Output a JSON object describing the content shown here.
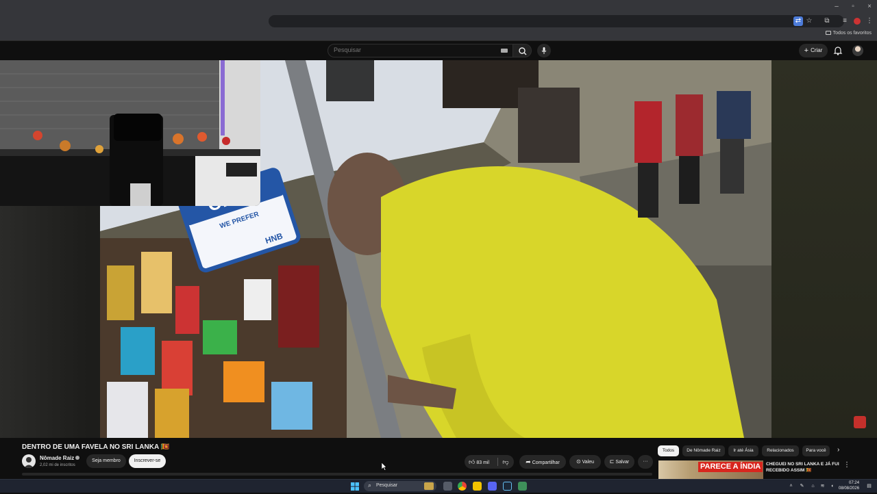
{
  "browser": {
    "bookmarks_all": "Todos os favoritos"
  },
  "youtube": {
    "search_placeholder": "Pesquisar",
    "create_label": "Criar"
  },
  "video": {
    "title": "DENTRO DE UMA FAVELA NO SRI LANKA 🇱🇰",
    "channel": "Nômade Raiz",
    "subscribers": "2,02 mi de inscritos",
    "member_label": "Seja membro",
    "subscribe_label": "Inscrever-se",
    "likes": "83 mil",
    "share_label": "Compartilhar",
    "thanks_label": "Valeu",
    "save_label": "Salvar",
    "overlay_sign": {
      "open": "OPEN",
      "we_prefer": "WE PREFER",
      "bank": "HNB"
    }
  },
  "chips": [
    "Todos",
    "De Nômade Raiz",
    "Ir até Ásia",
    "Relacionados",
    "Para você"
  ],
  "related": {
    "thumb_text": "PARECE A ÍNDIA",
    "title": "CHEGUEI NO SRI LANKA E JÁ FUI RECEBIDO ASSIM 🇱🇰"
  },
  "taskbar": {
    "search_label": "Pesquisar",
    "time": "07:24",
    "date": "08/08/2026"
  }
}
